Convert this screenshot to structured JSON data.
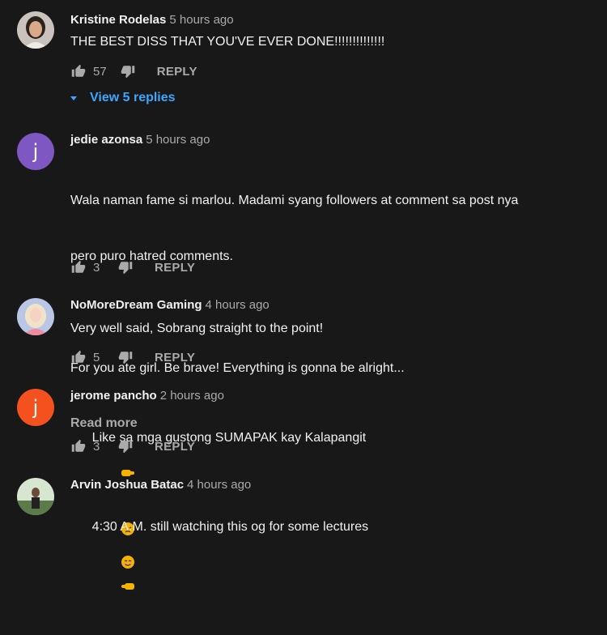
{
  "comments": [
    {
      "author": "Kristine Rodelas",
      "time": "5 hours ago",
      "body": "THE BEST DISS THAT YOU'VE EVER DONE!!!!!!!!!!!!!!",
      "likes": "57",
      "reply_label": "REPLY",
      "view_replies": "View 5 replies"
    },
    {
      "author": "jedie azonsa",
      "time": "5 hours ago",
      "avatar_letter": "j",
      "avatar_color": "#7e57c2",
      "body_line1": "Wala naman fame si marlou. Madami syang followers at comment sa post nya",
      "body_line2": "pero puro hatred comments.",
      "body_line3": "For you ate girl. Be brave! Everything is gonna be alright...",
      "read_more": "Read more",
      "likes": "3",
      "reply_label": "REPLY"
    },
    {
      "author": "NoMoreDream Gaming",
      "time": "4 hours ago",
      "body": "Very well said, Sobrang straight to the point!",
      "likes": "5",
      "reply_label": "REPLY"
    },
    {
      "author": "jerome pancho",
      "time": "2 hours ago",
      "avatar_letter": "j",
      "avatar_color": "#f4511e",
      "body": "Like sa mga gustong SUMAPAK kay Kalapangit",
      "likes": "3",
      "reply_label": "REPLY"
    },
    {
      "author": "Arvin Joshua Batac",
      "time": "4 hours ago",
      "body": "4:30 A.M. still watching this og for some lectures"
    }
  ],
  "colors": {
    "background": "#181818",
    "text": "#f1f1f1",
    "secondary": "#aaaaaa",
    "link": "#3ea6ff"
  }
}
